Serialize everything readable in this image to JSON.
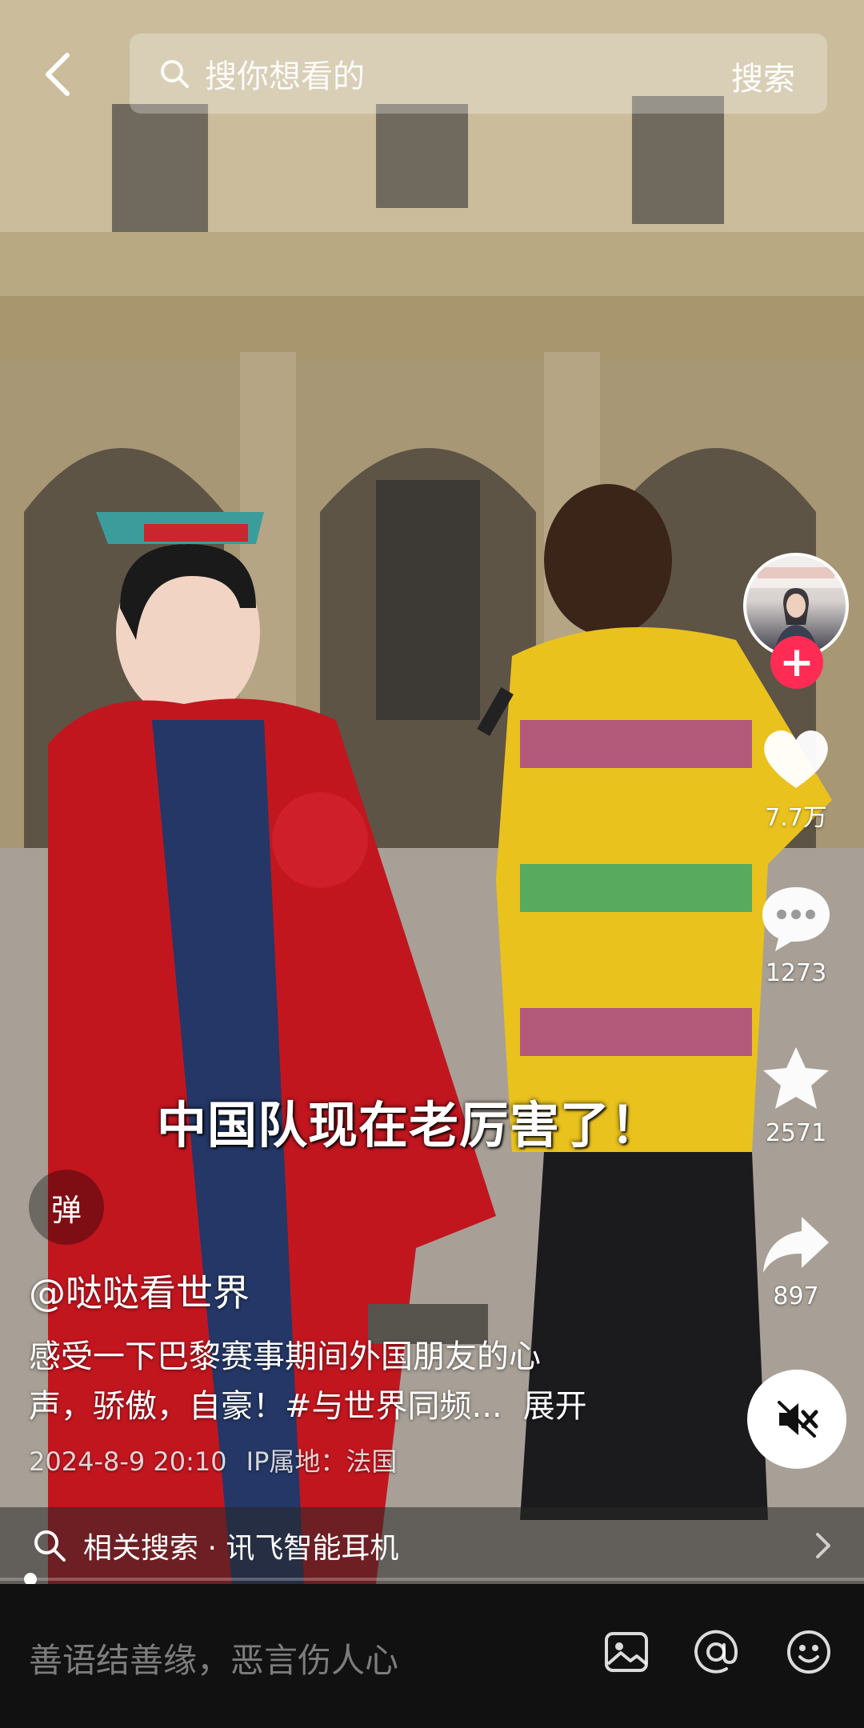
{
  "search": {
    "placeholder": "搜你想看的",
    "button": "搜索"
  },
  "video": {
    "subtitle": "中国队现在老厉害了！",
    "danmu_label": "弹"
  },
  "author": {
    "handle": "@哒哒看世界"
  },
  "description": {
    "line1": "感受一下巴黎赛事期间外国朋友的心",
    "line2": "声，骄傲，自豪！#与世界同频...",
    "expand": "展开"
  },
  "meta": {
    "datetime": "2024-8-9 20:10",
    "ip": "IP属地：法国"
  },
  "actions": {
    "likes": "7.7万",
    "comments": "1273",
    "favorites": "2571",
    "shares": "897"
  },
  "related": {
    "text": "相关搜索 · 讯飞智能耳机"
  },
  "comment": {
    "placeholder": "善语结善缘，恶言伤人心"
  },
  "icons": {
    "back": "back-arrow-icon",
    "search": "search-icon",
    "follow": "plus-icon",
    "like": "heart-icon",
    "comment": "comment-bubble-icon",
    "favorite": "star-icon",
    "share": "share-arrow-icon",
    "mute": "speaker-muted-icon",
    "image": "image-icon",
    "mention": "at-icon",
    "emoji": "emoji-icon"
  },
  "colors": {
    "follow_accent": "#fe2c55",
    "comment_bar_bg": "#111111"
  }
}
